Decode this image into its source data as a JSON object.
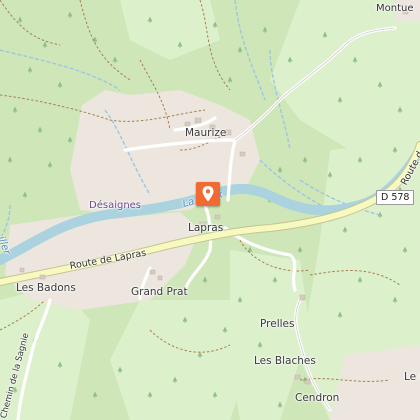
{
  "map": {
    "place_labels": {
      "montue": "Montue",
      "maurize": "Maurize",
      "desaignes": "Désaignes",
      "lapras": "Lapras",
      "les_badons": "Les Badons",
      "grand_prat": "Grand Prat",
      "prelles": "Prelles",
      "les_blaches": "Les Blaches",
      "cendron": "Cendron",
      "le_c": "Le C"
    },
    "river_label": "La Doux",
    "river_label_left": "iller",
    "road_labels": {
      "route_de_lapras": "Route de Lapras",
      "chemin_de_la_sagnie": "Chemin de la Sagnie",
      "route_d": "Route d"
    },
    "road_shield": "D 578",
    "marker_icon": "location-pin-icon",
    "colors": {
      "forest": "#cfe6b8",
      "meadow": "#ddf0cc",
      "residential": "#ece6df",
      "river": "#aad3df",
      "main_road": "#f7fabf",
      "marker": "#f26a32",
      "track": "#a8804f"
    }
  }
}
